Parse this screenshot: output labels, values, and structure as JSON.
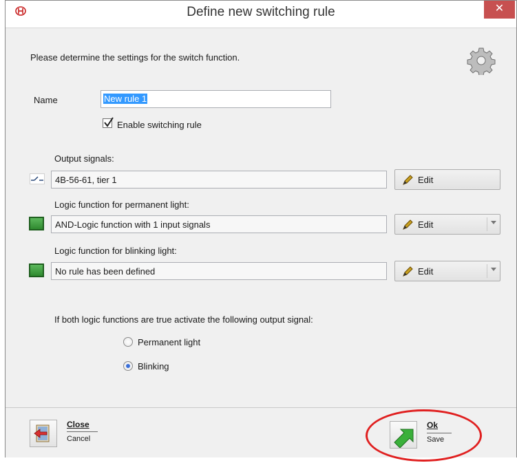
{
  "window": {
    "title": "Define new switching rule",
    "close_label": "✕"
  },
  "intro_text": "Please determine the settings for the switch function.",
  "name": {
    "label": "Name",
    "value": "New rule 1"
  },
  "enable": {
    "label": "Enable switching rule",
    "checked": true
  },
  "output": {
    "label": "Output signals:",
    "value": "4B-56-61, tier 1",
    "edit_label": "Edit"
  },
  "permanent": {
    "label": "Logic function for permanent light:",
    "value": "AND-Logic function with 1 input signals",
    "edit_label": "Edit"
  },
  "blinking": {
    "label": "Logic function for blinking light:",
    "value": "No rule has been defined",
    "edit_label": "Edit"
  },
  "activate": {
    "question": "If both logic functions are true activate the following output signal:",
    "options": [
      {
        "label": "Permanent light",
        "selected": false
      },
      {
        "label": "Blinking",
        "selected": true
      }
    ]
  },
  "footer": {
    "close": {
      "title": "Close",
      "subtitle": "Cancel"
    },
    "ok": {
      "title": "Ok",
      "subtitle": "Save"
    }
  },
  "colors": {
    "accent_green": "#3a9a3a",
    "highlight": "#e02020",
    "selection": "#3399ff",
    "close_button": "#c75050"
  }
}
